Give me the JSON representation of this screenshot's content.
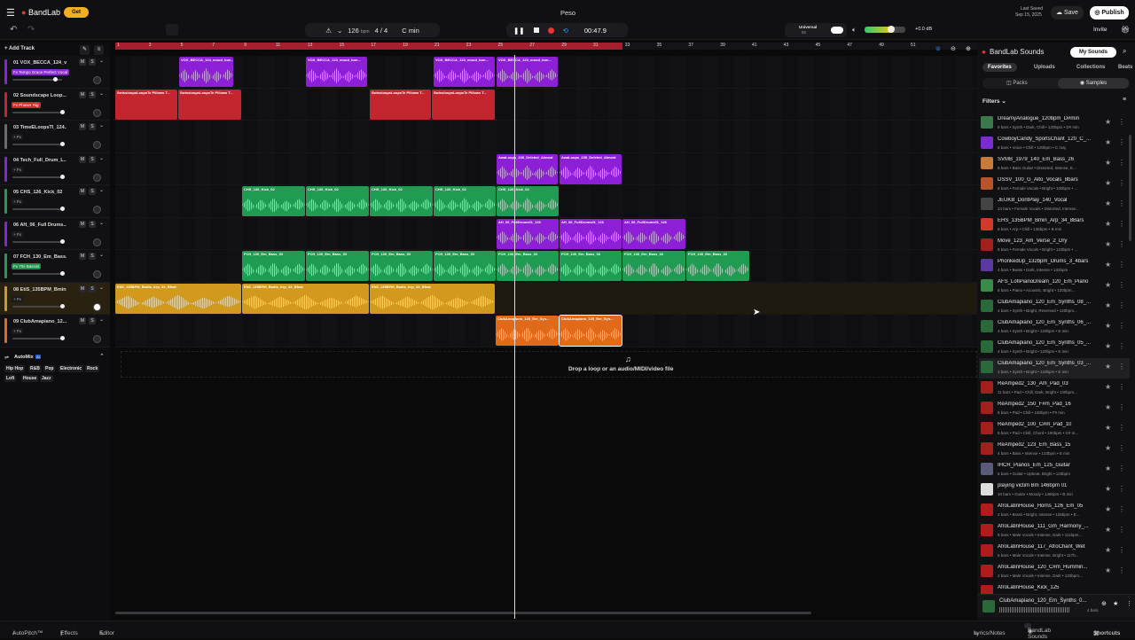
{
  "header": {
    "brand": "BandLab",
    "get_label": "Get",
    "project_title": "Peso",
    "last_saved_label": "Last Saved",
    "last_saved_date": "Sep 15, 2025",
    "save_label": "Save",
    "publish_label": "Publish",
    "invite_label": "Invite",
    "tempo": "126",
    "tempo_unit": "bpm",
    "time_sig": "4 / 4",
    "key": "C min",
    "time": "00:47.9",
    "universal_label": "Universal",
    "universal_value": "50",
    "volume_db": "+0.0 dB"
  },
  "toolbar": {
    "add_track_label": "Add Track"
  },
  "tracks": [
    {
      "num": "01",
      "name": "VOX_BECCA_124_v...",
      "fx": "Fx Tempo Grace Perfect Vocal",
      "c": "#8d1fd6"
    },
    {
      "num": "02",
      "name": "Soundscape Loop...",
      "fx": "Fx Phaser Rig",
      "c": "#c4242e"
    },
    {
      "num": "03",
      "name": "TimeELoopsTl_124...",
      "fx": "+ Fx",
      "c": "#6a6a70"
    },
    {
      "num": "04",
      "name": "Tech_Full_Drum_L...",
      "fx": "+ Fx",
      "c": "#8d1fd6"
    },
    {
      "num": "05",
      "name": "CHS_126_Kick_02",
      "fx": "+ Fx",
      "c": "#1f9b52"
    },
    {
      "num": "06",
      "name": "AH_06_Full Drums...",
      "fx": "+ Fx",
      "c": "#8d1fd6"
    },
    {
      "num": "07",
      "name": "FCH_130_Em_Bass...",
      "fx": "Fx 70s Bassist",
      "c": "#1f9b52"
    },
    {
      "num": "08",
      "name": "EtiS_135BPM_Bmin...",
      "fx": "+ Fx",
      "c": "#d19a1c"
    },
    {
      "num": "09",
      "name": "ClubAmapiano_12...",
      "fx": "+ Fx",
      "c": "#e06a1a"
    }
  ],
  "automix": {
    "label": "AutoMix",
    "badge": "AI",
    "genres": [
      "Hip Hop",
      "R&B",
      "Pop",
      "Electronic",
      "Rock",
      "Lofi",
      "House",
      "Jazz"
    ]
  },
  "ruler": [
    "1",
    "3",
    "5",
    "7",
    "9",
    "11",
    "13",
    "15",
    "17",
    "19",
    "21",
    "23",
    "25",
    "27",
    "29",
    "31",
    "33",
    "35",
    "37",
    "39",
    "41",
    "43",
    "45",
    "47",
    "49",
    "51"
  ],
  "clips": {
    "t1": "VOX_BECCA_124_mood_bon...",
    "t2": "SwissloopsLoopsTe Pillows T...",
    "t4": "AwaLoops_235_Deleted_Almost",
    "t4b": "AwaLoops_235_Deleted_Almost",
    "t5": "CHS_126_Kick_02",
    "t6": "AH_06_FullDrums01_126",
    "t7": "FCH_130_Em_Bass_03",
    "t8": "EtiS_135BPM_Badla_Arp_34_Bfeat",
    "t9": "ClubAmapiano_120_Em_Syn..."
  },
  "drop_text": "Drop a loop or an audio/MIDI/video file",
  "sounds": {
    "title": "BandLab Sounds",
    "my_sounds": "My Sounds",
    "tabs": [
      "Favorites",
      "Uploads",
      "Collections",
      "Beats"
    ],
    "sub": [
      "Packs",
      "Samples"
    ],
    "filters": "Filters",
    "items": [
      {
        "t": "DreamyAnalogue_120bpm_D#min",
        "s": "9 bars • Synth • Dark, Chill • 120bpm • D# min",
        "c": "#3a7a4a"
      },
      {
        "t": "CowboyCandy_SportsChant_120_C_...",
        "s": "8 bars • Voice • Chill • 120bpm • C maj",
        "c": "#7a2bd1"
      },
      {
        "t": "SVMB_1979_140_Em_Bass_26",
        "s": "8 bars • Bass Guitar • Distorted, Intense, E...",
        "c": "#c77a3a"
      },
      {
        "t": "DSSV_100_G_Alto_Vocals_8bars",
        "s": "8 bars • Female Vocals • Bright • 100bpm • ...",
        "c": "#b6542c"
      },
      {
        "t": "JEUKB_DontPlay_140_Vocal",
        "s": "24 bars • Female Vocals • Distorted, Intense...",
        "c": "#444"
      },
      {
        "t": "EHS_135BPM_Bmin_Arp_34_8Bars",
        "s": "8 bars • Arp • Chill • 135bpm • B min",
        "c": "#d03a2a"
      },
      {
        "t": "Move_123_Am_Verse_2_Dry",
        "s": "8 bars • Female Vocals • Bright • 123bpm • ...",
        "c": "#a0201e"
      },
      {
        "t": "PhonkedUp_132bpm_Drums_3_4bars",
        "s": "4 bars • Beats • Dark, Intense • 132bpm",
        "c": "#5b3aa0"
      },
      {
        "t": "AFS_LofiPianoDream_120_Em_Piano",
        "s": "8 bars • Piano • Acoustic, Bright • 120bpm...",
        "c": "#3a8a4a"
      },
      {
        "t": "ClubAmapiano_120_Em_Synths_08_...",
        "s": "4 bars • Synth • Bright, Reversed • 120bpm...",
        "c": "#2a6a3a"
      },
      {
        "t": "ClubAmapiano_120_Em_Synths_06_...",
        "s": "4 bars • Synth • Bright • 120bpm • E min",
        "c": "#2a6a3a"
      },
      {
        "t": "ClubAmapiano_120_Em_Synths_05_...",
        "s": "4 bars • Synth • Bright • 120bpm • E min",
        "c": "#2a6a3a"
      },
      {
        "t": "ClubAmapiano_120_Em_Synths_03_...",
        "s": "4 bars • Synth • Bright • 120bpm • E min",
        "c": "#2a6a3a"
      },
      {
        "t": "ReAmped2_130_Am_Pad_03",
        "s": "11 bars • Pad • Chill, Dark, Bright • 130bpm...",
        "c": "#a0201e"
      },
      {
        "t": "ReAmped2_150_F#m_Pad_16",
        "s": "8 bars • Pad • Chill • 150bpm • F# min",
        "c": "#a0201e"
      },
      {
        "t": "ReAmped2_100_C#m_Pad_10",
        "s": "8 bars • Pad • Chill, Chord • 100bpm • C# m...",
        "c": "#a0201e"
      },
      {
        "t": "ReAmped2_123_Em_Bass_15",
        "s": "4 bars • Bass • Intense • 123bpm • E min",
        "c": "#a0201e"
      },
      {
        "t": "IHCR_Pianos_Em_125_Guitar",
        "s": "6 bars • Guitar • Upbeat, Bright • 125bpm",
        "c": "#5a5a7a"
      },
      {
        "t": "playing victim Bm 146bpm 01",
        "s": "10 bars • Guitar • Moody • 146bpm • B min",
        "c": "#ddd"
      },
      {
        "t": "AfroLatinHouse_Horns_126_Em_05",
        "s": "2 bars • Brass • Bright, Intense • 126bpm • E...",
        "c": "#b01c1c"
      },
      {
        "t": "AfroLatinHouse_111_Gm_Harmony_...",
        "s": "8 bars • Male Vocals • Intense, Dark • 111bpm...",
        "c": "#b01c1c"
      },
      {
        "t": "AfroLatinHouse_117_AfroChant_Wet",
        "s": "5 bars • Male Vocals • Intense, Bright • 117b...",
        "c": "#b01c1c"
      },
      {
        "t": "AfroLatinHouse_120_C#m_Hummin...",
        "s": "2 bars • Male Vocals • Intense, Dark • 120bpm...",
        "c": "#b01c1c"
      },
      {
        "t": "AfroLatinHouse_Kick_125",
        "s": "",
        "c": "#b01c1c"
      }
    ],
    "player": {
      "t": "ClubAmapiano_120_Em_Synths_0...",
      "bars": "4 bars"
    }
  },
  "bottom": {
    "autopitch": "AutoPitch™",
    "effects": "Effects",
    "editor": "Editor",
    "lyrics": "Lyrics/Notes",
    "sounds": "BandLab Sounds",
    "shortcuts": "Shortcuts"
  }
}
